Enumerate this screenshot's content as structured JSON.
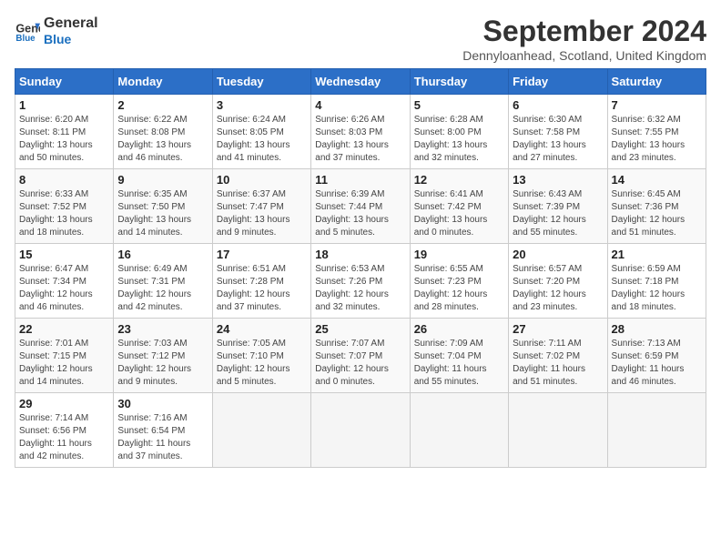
{
  "header": {
    "logo_line1": "General",
    "logo_line2": "Blue",
    "month_title": "September 2024",
    "subtitle": "Dennyloanhead, Scotland, United Kingdom"
  },
  "columns": [
    "Sunday",
    "Monday",
    "Tuesday",
    "Wednesday",
    "Thursday",
    "Friday",
    "Saturday"
  ],
  "weeks": [
    [
      {
        "day": "1",
        "info": "Sunrise: 6:20 AM\nSunset: 8:11 PM\nDaylight: 13 hours\nand 50 minutes."
      },
      {
        "day": "2",
        "info": "Sunrise: 6:22 AM\nSunset: 8:08 PM\nDaylight: 13 hours\nand 46 minutes."
      },
      {
        "day": "3",
        "info": "Sunrise: 6:24 AM\nSunset: 8:05 PM\nDaylight: 13 hours\nand 41 minutes."
      },
      {
        "day": "4",
        "info": "Sunrise: 6:26 AM\nSunset: 8:03 PM\nDaylight: 13 hours\nand 37 minutes."
      },
      {
        "day": "5",
        "info": "Sunrise: 6:28 AM\nSunset: 8:00 PM\nDaylight: 13 hours\nand 32 minutes."
      },
      {
        "day": "6",
        "info": "Sunrise: 6:30 AM\nSunset: 7:58 PM\nDaylight: 13 hours\nand 27 minutes."
      },
      {
        "day": "7",
        "info": "Sunrise: 6:32 AM\nSunset: 7:55 PM\nDaylight: 13 hours\nand 23 minutes."
      }
    ],
    [
      {
        "day": "8",
        "info": "Sunrise: 6:33 AM\nSunset: 7:52 PM\nDaylight: 13 hours\nand 18 minutes."
      },
      {
        "day": "9",
        "info": "Sunrise: 6:35 AM\nSunset: 7:50 PM\nDaylight: 13 hours\nand 14 minutes."
      },
      {
        "day": "10",
        "info": "Sunrise: 6:37 AM\nSunset: 7:47 PM\nDaylight: 13 hours\nand 9 minutes."
      },
      {
        "day": "11",
        "info": "Sunrise: 6:39 AM\nSunset: 7:44 PM\nDaylight: 13 hours\nand 5 minutes."
      },
      {
        "day": "12",
        "info": "Sunrise: 6:41 AM\nSunset: 7:42 PM\nDaylight: 13 hours\nand 0 minutes."
      },
      {
        "day": "13",
        "info": "Sunrise: 6:43 AM\nSunset: 7:39 PM\nDaylight: 12 hours\nand 55 minutes."
      },
      {
        "day": "14",
        "info": "Sunrise: 6:45 AM\nSunset: 7:36 PM\nDaylight: 12 hours\nand 51 minutes."
      }
    ],
    [
      {
        "day": "15",
        "info": "Sunrise: 6:47 AM\nSunset: 7:34 PM\nDaylight: 12 hours\nand 46 minutes."
      },
      {
        "day": "16",
        "info": "Sunrise: 6:49 AM\nSunset: 7:31 PM\nDaylight: 12 hours\nand 42 minutes."
      },
      {
        "day": "17",
        "info": "Sunrise: 6:51 AM\nSunset: 7:28 PM\nDaylight: 12 hours\nand 37 minutes."
      },
      {
        "day": "18",
        "info": "Sunrise: 6:53 AM\nSunset: 7:26 PM\nDaylight: 12 hours\nand 32 minutes."
      },
      {
        "day": "19",
        "info": "Sunrise: 6:55 AM\nSunset: 7:23 PM\nDaylight: 12 hours\nand 28 minutes."
      },
      {
        "day": "20",
        "info": "Sunrise: 6:57 AM\nSunset: 7:20 PM\nDaylight: 12 hours\nand 23 minutes."
      },
      {
        "day": "21",
        "info": "Sunrise: 6:59 AM\nSunset: 7:18 PM\nDaylight: 12 hours\nand 18 minutes."
      }
    ],
    [
      {
        "day": "22",
        "info": "Sunrise: 7:01 AM\nSunset: 7:15 PM\nDaylight: 12 hours\nand 14 minutes."
      },
      {
        "day": "23",
        "info": "Sunrise: 7:03 AM\nSunset: 7:12 PM\nDaylight: 12 hours\nand 9 minutes."
      },
      {
        "day": "24",
        "info": "Sunrise: 7:05 AM\nSunset: 7:10 PM\nDaylight: 12 hours\nand 5 minutes."
      },
      {
        "day": "25",
        "info": "Sunrise: 7:07 AM\nSunset: 7:07 PM\nDaylight: 12 hours\nand 0 minutes."
      },
      {
        "day": "26",
        "info": "Sunrise: 7:09 AM\nSunset: 7:04 PM\nDaylight: 11 hours\nand 55 minutes."
      },
      {
        "day": "27",
        "info": "Sunrise: 7:11 AM\nSunset: 7:02 PM\nDaylight: 11 hours\nand 51 minutes."
      },
      {
        "day": "28",
        "info": "Sunrise: 7:13 AM\nSunset: 6:59 PM\nDaylight: 11 hours\nand 46 minutes."
      }
    ],
    [
      {
        "day": "29",
        "info": "Sunrise: 7:14 AM\nSunset: 6:56 PM\nDaylight: 11 hours\nand 42 minutes."
      },
      {
        "day": "30",
        "info": "Sunrise: 7:16 AM\nSunset: 6:54 PM\nDaylight: 11 hours\nand 37 minutes."
      },
      {
        "day": "",
        "info": ""
      },
      {
        "day": "",
        "info": ""
      },
      {
        "day": "",
        "info": ""
      },
      {
        "day": "",
        "info": ""
      },
      {
        "day": "",
        "info": ""
      }
    ]
  ]
}
